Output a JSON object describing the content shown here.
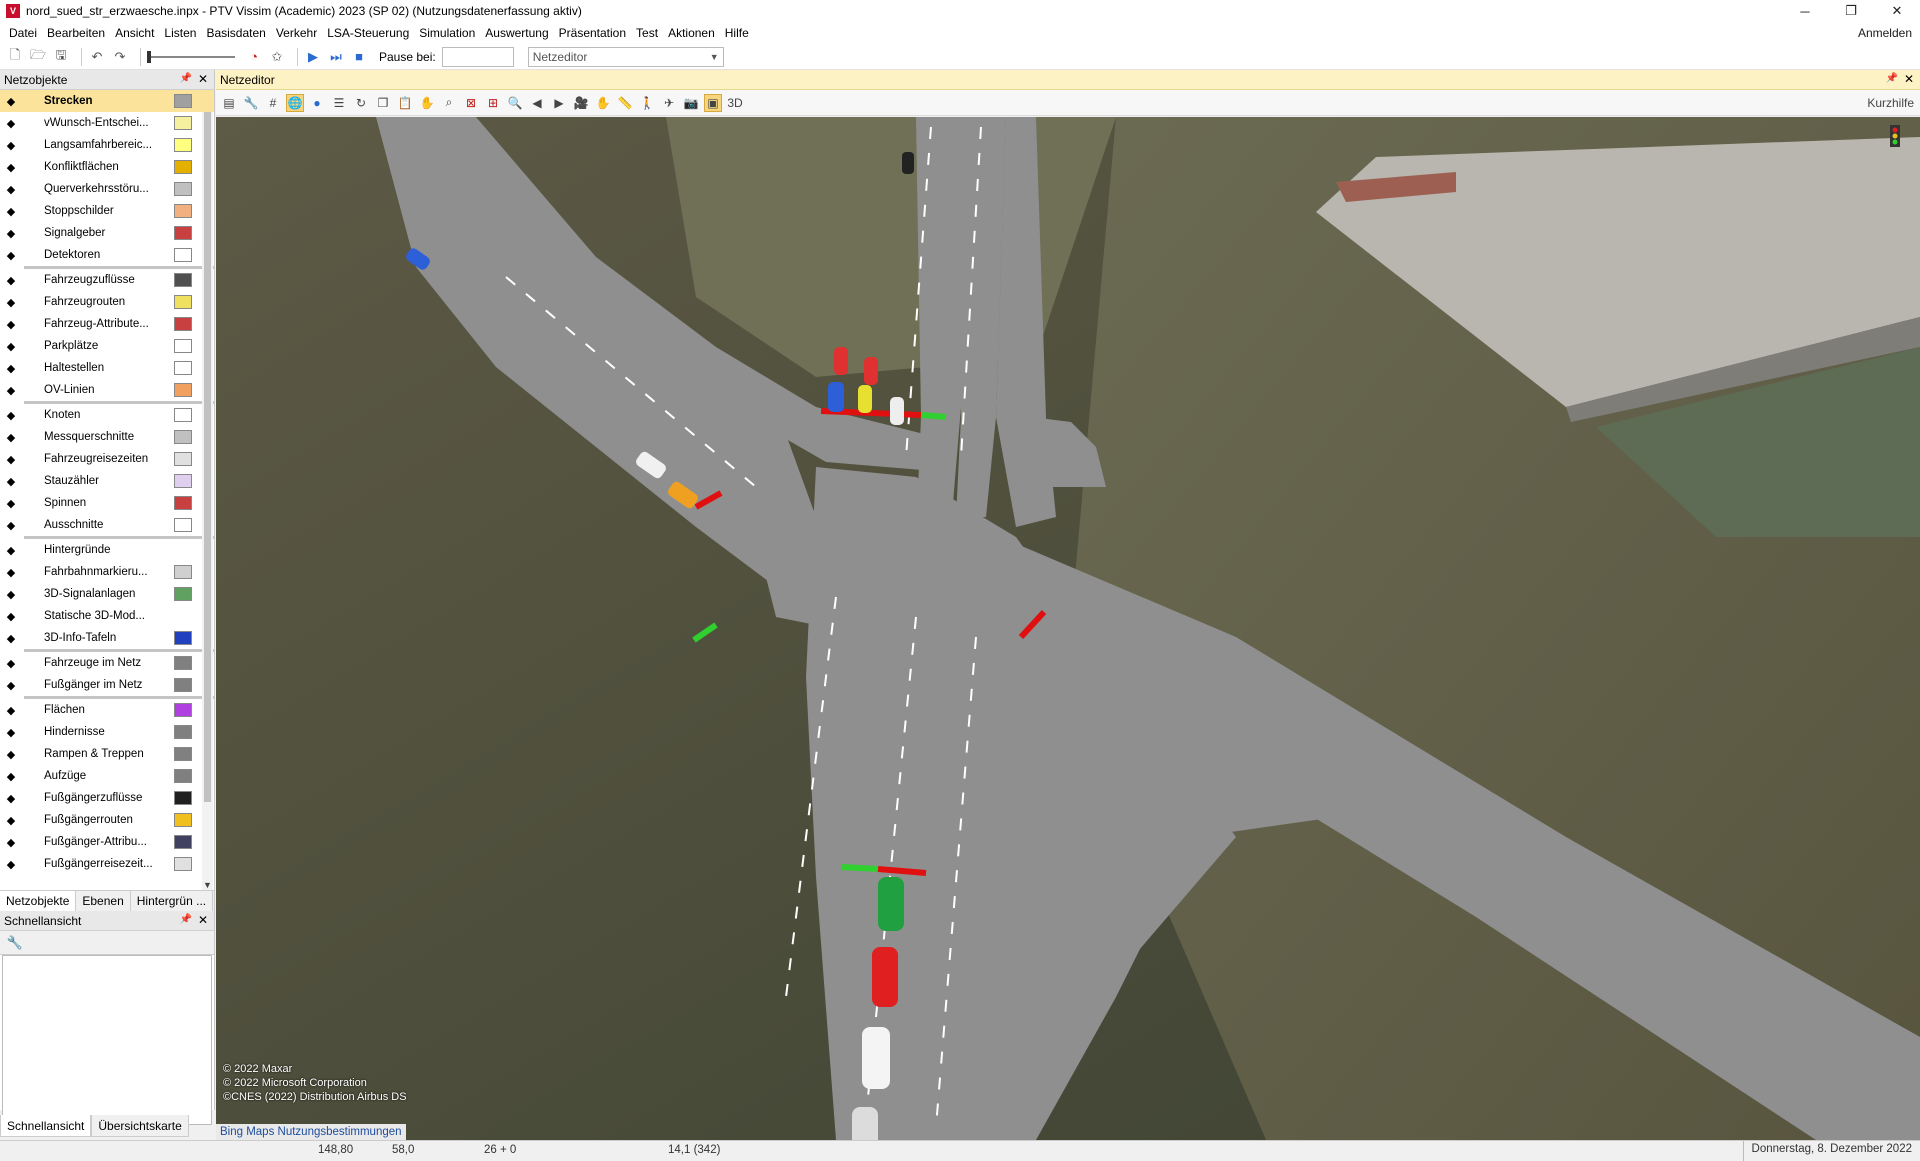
{
  "window": {
    "title": "nord_sued_str_erzwaesche.inpx - PTV Vissim (Academic) 2023 (SP 02) (Nutzungsdatenerfassung aktiv)",
    "minimize": "─",
    "maximize": "❐",
    "close": "✕"
  },
  "menu": {
    "items": [
      "Datei",
      "Bearbeiten",
      "Ansicht",
      "Listen",
      "Basisdaten",
      "Verkehr",
      "LSA-Steuerung",
      "Simulation",
      "Auswertung",
      "Präsentation",
      "Test",
      "Aktionen",
      "Hilfe"
    ],
    "login": "Anmelden"
  },
  "toolbar": {
    "pause_label": "Pause bei:",
    "pause_value": "",
    "mode_value": "Netzeditor"
  },
  "netobjects": {
    "title": "Netzobjekte",
    "items": [
      {
        "label": "Strecken",
        "icon": "road-icon",
        "swatch": "#a0a0a0",
        "selected": true
      },
      {
        "label": "vWunsch-Entschei...",
        "icon": "speed-50-icon",
        "swatch": "#f5f0a0"
      },
      {
        "label": "Langsamfahrbereic...",
        "icon": "warning-triangle-icon",
        "swatch": "#ffff80"
      },
      {
        "label": "Konfliktflächen",
        "icon": "conflict-icon",
        "swatch": "#e4b000"
      },
      {
        "label": "Querverkehrsstöru...",
        "icon": "yield-icon",
        "swatch": "#c0c0c0"
      },
      {
        "label": "Stoppschilder",
        "icon": "stop-sign-icon",
        "swatch": "#f2b080"
      },
      {
        "label": "Signalgeber",
        "icon": "signal-head-icon",
        "swatch": "#c84040"
      },
      {
        "label": "Detektoren",
        "icon": "detector-icon",
        "swatch": "#ffffff"
      },
      {
        "label": "Fahrzeugzuflüsse",
        "icon": "vehicle-input-icon",
        "swatch": "#505050"
      },
      {
        "label": "Fahrzeugrouten",
        "icon": "vehicle-route-icon",
        "swatch": "#f0e060"
      },
      {
        "label": "Fahrzeug-Attribute...",
        "icon": "vehicle-attr-icon",
        "swatch": "#c84040"
      },
      {
        "label": "Parkplätze",
        "icon": "parking-icon",
        "swatch": "#ffffff"
      },
      {
        "label": "Haltestellen",
        "icon": "bus-stop-icon",
        "swatch": "#ffffff"
      },
      {
        "label": "ÖV-Linien",
        "icon": "pt-line-icon",
        "swatch": "#f2a060"
      },
      {
        "label": "Knoten",
        "icon": "node-icon",
        "swatch": "#ffffff"
      },
      {
        "label": "Messquerschnitte",
        "icon": "data-collection-icon",
        "swatch": "#c0c0c0"
      },
      {
        "label": "Fahrzeugreisezeiten",
        "icon": "travel-time-icon",
        "swatch": "#e0e0e0"
      },
      {
        "label": "Stauzähler",
        "icon": "queue-counter-icon",
        "swatch": "#e0d0f0"
      },
      {
        "label": "Spinnen",
        "icon": "spider-icon",
        "swatch": "#c84040"
      },
      {
        "label": "Ausschnitte",
        "icon": "section-icon",
        "swatch": "#ffffff"
      },
      {
        "label": "Hintergründe",
        "icon": "background-icon",
        "swatch": ""
      },
      {
        "label": "Fahrbahnmarkieru...",
        "icon": "pavement-marking-icon",
        "swatch": "#d0d0d0"
      },
      {
        "label": "3D-Signalanlagen",
        "icon": "3d-signal-icon",
        "swatch": "#60a060"
      },
      {
        "label": "Statische 3D-Mod...",
        "icon": "static-3d-icon",
        "swatch": ""
      },
      {
        "label": "3D-Info-Tafeln",
        "icon": "info-sign-icon",
        "swatch": "#2040c0"
      },
      {
        "label": "Fahrzeuge im Netz",
        "icon": "vehicles-in-net-icon",
        "swatch": "#808080"
      },
      {
        "label": "Fußgänger im Netz",
        "icon": "pedestrians-in-net-icon",
        "swatch": "#808080"
      },
      {
        "label": "Flächen",
        "icon": "area-icon",
        "swatch": "#b040e0"
      },
      {
        "label": "Hindernisse",
        "icon": "obstacle-icon",
        "swatch": "#808080"
      },
      {
        "label": "Rampen & Treppen",
        "icon": "ramp-icon",
        "swatch": "#808080"
      },
      {
        "label": "Aufzüge",
        "icon": "elevator-icon",
        "swatch": "#808080"
      },
      {
        "label": "Fußgängerzuflüsse",
        "icon": "ped-input-icon",
        "swatch": "#202020"
      },
      {
        "label": "Fußgängerrouten",
        "icon": "ped-route-icon",
        "swatch": "#f0c020"
      },
      {
        "label": "Fußgänger-Attribu...",
        "icon": "ped-attr-icon",
        "swatch": "#404060"
      },
      {
        "label": "Fußgängerreisezeit...",
        "icon": "ped-travel-time-icon",
        "swatch": "#e0e0e0"
      }
    ],
    "tabs": [
      "Netzobjekte",
      "Ebenen",
      "Hintergrün ..."
    ]
  },
  "quickview": {
    "title": "Schnellansicht",
    "bottom_tabs": [
      "Schnellansicht",
      "Übersichtskarte"
    ]
  },
  "editor": {
    "title": "Netzeditor",
    "help": "Kurzhilfe",
    "copyright": [
      "© 2022 Maxar",
      "© 2022 Microsoft Corporation",
      "©CNES (2022) Distribution Airbus DS"
    ],
    "bing_terms": "Bing Maps Nutzungsbestimmungen"
  },
  "status": {
    "x": "148,80",
    "y": "58,0",
    "sim": "26 + 0",
    "zoom": "14,1 (342)",
    "date": "Donnerstag, 8. Dezember 2022"
  }
}
